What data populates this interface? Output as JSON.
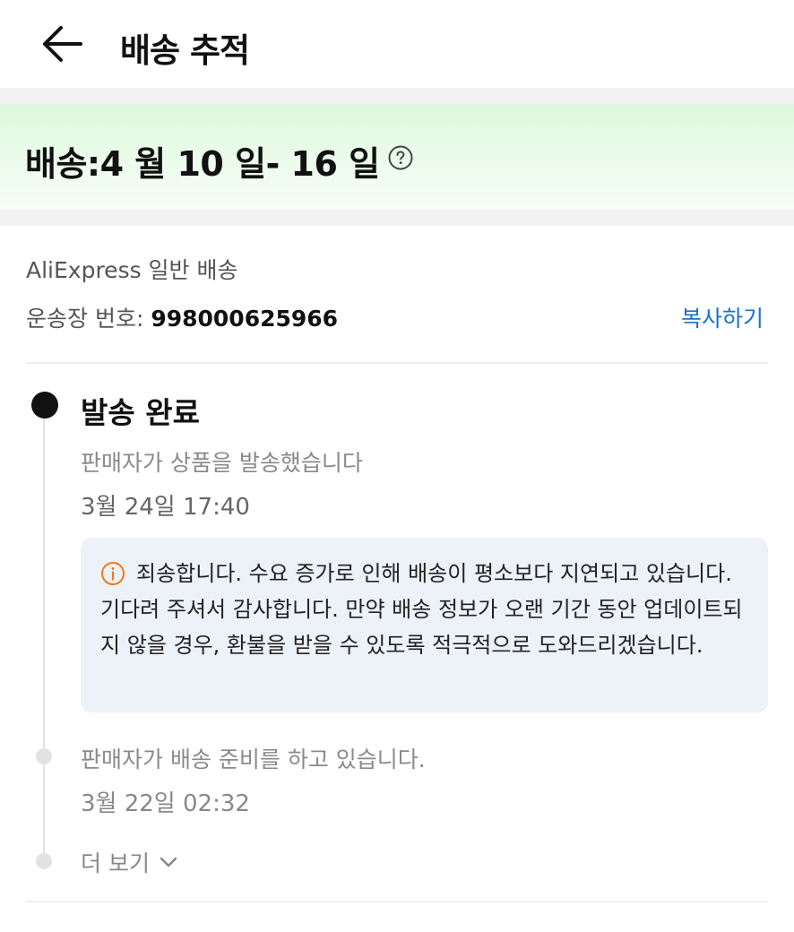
{
  "header": {
    "title": "배송 추적"
  },
  "eta": {
    "text": "배송:4 월 10 일- 16 일"
  },
  "shipment": {
    "carrier": "AliExpress 일반 배송",
    "tracking_label": "운송장 번호: ",
    "tracking_number": "998000625966",
    "copy_label": "복사하기"
  },
  "timeline": {
    "events": [
      {
        "title": "발송 완료",
        "description": "판매자가 상품을 발송했습니다",
        "time": "3월 24일 17:40"
      },
      {
        "description": "판매자가 배송 준비를 하고 있습니다.",
        "time": "3월 22일 02:32"
      }
    ],
    "notice": "죄송합니다. 수요 증가로 인해 배송이 평소보다 지연되고 있습니다. 기다려 주셔서 감사합니다. 만약 배송 정보가 오랜 기간 동안 업데이트되지 않을 경우, 환불을 받을 수 있도록 적극적으로 도와드리겠습니다.",
    "more_label": "더 보기"
  },
  "colors": {
    "accent_link": "#1a73c8",
    "eta_band": "#dcf8dc",
    "notice_bg": "#edf1f8",
    "warning_icon": "#f07a1a"
  },
  "icons": {
    "back": "arrow-left-icon",
    "help": "question-circle-icon",
    "notice": "info-circle-icon",
    "more": "chevron-down-icon"
  }
}
